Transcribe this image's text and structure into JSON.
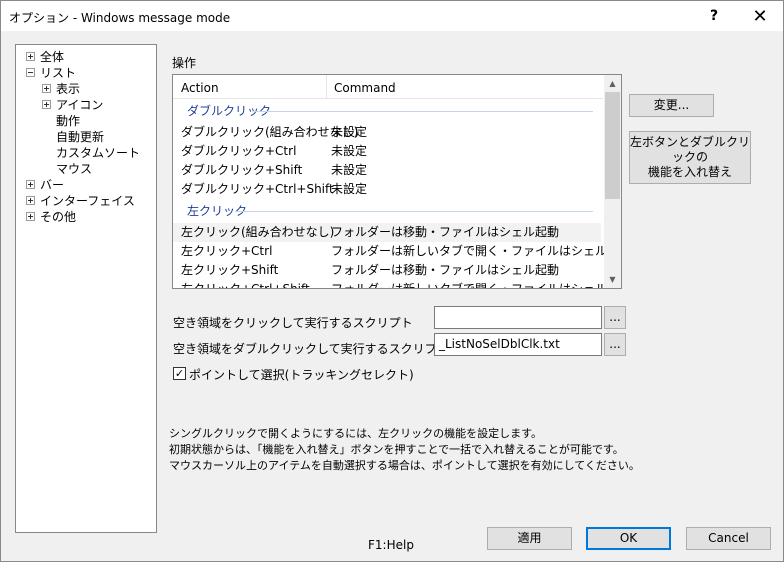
{
  "window": {
    "title": "オプション - Windows message mode",
    "help_glyph": "?",
    "close_glyph": "✕"
  },
  "tree": {
    "items": [
      {
        "label": "全体",
        "expander": "plus"
      },
      {
        "label": "リスト",
        "expander": "minus"
      },
      {
        "label": "表示",
        "expander": "plus"
      },
      {
        "label": "アイコン",
        "expander": "plus"
      },
      {
        "label": "動作",
        "expander": "none"
      },
      {
        "label": "自動更新",
        "expander": "none"
      },
      {
        "label": "カスタムソート",
        "expander": "none"
      },
      {
        "label": "マウス",
        "expander": "none"
      },
      {
        "label": "バー",
        "expander": "plus"
      },
      {
        "label": "インターフェイス",
        "expander": "plus"
      },
      {
        "label": "その他",
        "expander": "plus"
      }
    ]
  },
  "operations": {
    "group_label": "操作",
    "columns": [
      "Action",
      "Command"
    ],
    "groups": [
      {
        "title": "ダブルクリック",
        "rows": [
          {
            "action": "ダブルクリック(組み合わせなし)",
            "command": "未設定"
          },
          {
            "action": "ダブルクリック+Ctrl",
            "command": "未設定"
          },
          {
            "action": "ダブルクリック+Shift",
            "command": "未設定"
          },
          {
            "action": "ダブルクリック+Ctrl+Shift",
            "command": "未設定"
          }
        ]
      },
      {
        "title": "左クリック",
        "rows": [
          {
            "action": "左クリック(組み合わせなし)",
            "command": "フォルダーは移動・ファイルはシェル起動"
          },
          {
            "action": "左クリック+Ctrl",
            "command": "フォルダーは新しいタブで開く・ファイルはシェル起動"
          },
          {
            "action": "左クリック+Shift",
            "command": "フォルダーは移動・ファイルはシェル起動"
          },
          {
            "action": "左クリック+Ctrl+Shift",
            "command": "フォルダーは新しいタブで開く・ファイルはシェル起動"
          }
        ]
      }
    ],
    "change_button": "変更...",
    "swap_button_line1": "左ボタンとダブルクリックの",
    "swap_button_line2": "機能を入れ替え"
  },
  "scripts": {
    "click_label": "空き領域をクリックして実行するスクリプト",
    "click_value": "",
    "dblclick_label": "空き領域をダブルクリックして実行するスクリプト",
    "dblclick_value": "_ListNoSelDblClk.txt",
    "browse_label": "..."
  },
  "tracking": {
    "checked": true,
    "check_glyph": "✓",
    "label": "ポイントして選択(トラッキングセレクト)"
  },
  "description": {
    "line1": "シングルクリックで開くようにするには、左クリックの機能を設定します。",
    "line2": "初期状態からは、「機能を入れ替え」ボタンを押すことで一括で入れ替えることが可能です。",
    "line3": "マウスカーソル上のアイテムを自動選択する場合は、ポイントして選択を有効にしてください。"
  },
  "footer": {
    "help_text": "F1:Help",
    "apply": "適用",
    "ok": "OK",
    "cancel": "Cancel"
  },
  "colors": {
    "group_title": "#1e3f99",
    "default_button_border": "#0078d7"
  }
}
